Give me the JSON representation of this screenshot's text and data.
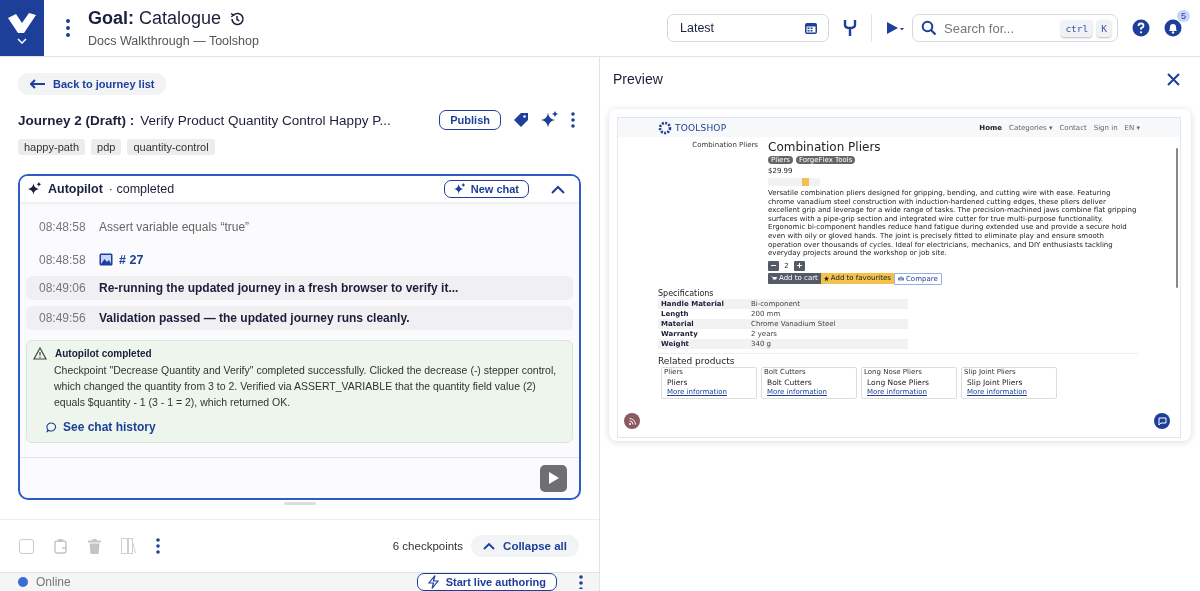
{
  "header": {
    "goal_label": "Goal:",
    "goal_name": "Catalogue",
    "subtitle": "Docs Walkthrough — Toolshop",
    "version": "Latest",
    "search_placeholder": "Search for...",
    "shortcut": [
      "ctrl",
      "K"
    ],
    "notifications": "5"
  },
  "back": "Back to journey list",
  "journey": {
    "prefix": "Journey 2 (Draft) :",
    "title": "Verify Product Quantity Control Happy P...",
    "publish": "Publish",
    "tags": [
      "happy-path",
      "pdp",
      "quantity-control"
    ]
  },
  "autopilot": {
    "title": "Autopilot",
    "status": "· completed",
    "new_chat": "New chat",
    "expanded": true,
    "log": [
      {
        "kind": "text",
        "time": "08:48:58",
        "text": "Assert variable equals “true”"
      },
      {
        "kind": "image",
        "time": "08:48:58",
        "text": "# 27"
      },
      {
        "kind": "status",
        "time": "08:49:06",
        "text": "Re-running the updated journey in a fresh browser to verify it..."
      },
      {
        "kind": "status",
        "time": "08:49:56",
        "text": "Validation passed — the updated journey runs cleanly."
      }
    ],
    "result": {
      "title": "Autopilot completed",
      "body": "Checkpoint \"Decrease Quantity and Verify\" completed successfully. Clicked the decrease (-) stepper control, which changed the quantity from 3 to 2. Verified via ASSERT_VARIABLE that the quantity field value (2) equals $quantity - 1 (3 - 1 = 2), which returned OK.",
      "link": "See chat history"
    }
  },
  "toolbar": {
    "checked": false,
    "count": "6 checkpoints",
    "collapse": "Collapse all"
  },
  "status": {
    "label": "Online",
    "online": true,
    "button": "Start live authoring"
  },
  "preview": {
    "title": "Preview",
    "page": {
      "logo": "TOOLSHOP",
      "nav": [
        {
          "label": "Home",
          "selected": true
        },
        {
          "label": "Categories ▾",
          "selected": false
        },
        {
          "label": "Contact",
          "selected": false
        },
        {
          "label": "Sign in",
          "selected": false
        },
        {
          "label": "EN ▾",
          "selected": false
        }
      ],
      "image_alt": "Combination Pliers",
      "name": "Combination Pliers",
      "badges": [
        "Pliers",
        "ForgeFlex Tools"
      ],
      "price": "$29.99",
      "description": "Versatile combination pliers designed for gripping, bending, and cutting wire with ease. Featuring chrome vanadium steel construction with induction-hardened cutting edges, these pliers deliver excellent grip and leverage for a wide range of tasks. The precision-machined jaws combine flat gripping surfaces with a pipe-grip section and integrated wire cutter for true multi-purpose functionality. Ergonomic bi-component handles reduce hand fatigue during extended use and provide a secure hold even with oily or gloved hands. The joint is precisely fitted to eliminate play and ensure smooth operation over thousands of cycles. Ideal for electricians, mechanics, and DIY enthusiasts tackling everyday projects around the workshop or job site.",
      "quantity": "2",
      "buttons": [
        {
          "kind": "cart",
          "label": "Add to cart"
        },
        {
          "kind": "favourite",
          "label": "Add to favourites"
        },
        {
          "kind": "compare",
          "label": "Compare"
        }
      ],
      "specs_title": "Specifications",
      "specs": [
        {
          "name": "Handle Material",
          "value": "Bi-component"
        },
        {
          "name": "Length",
          "value": "200 mm"
        },
        {
          "name": "Material",
          "value": "Chrome Vanadium Steel"
        },
        {
          "name": "Warranty",
          "value": "2 years"
        },
        {
          "name": "Weight",
          "value": "340 g"
        }
      ],
      "related_title": "Related products",
      "related": [
        {
          "alt": "Pliers",
          "name": "Pliers",
          "link": "More information"
        },
        {
          "alt": "Bolt Cutters",
          "name": "Bolt Cutters",
          "link": "More information"
        },
        {
          "alt": "Long Nose Pliers",
          "name": "Long Nose Pliers",
          "link": "More information"
        },
        {
          "alt": "Slip Joint Pliers",
          "name": "Slip Joint Pliers",
          "link": "More information"
        }
      ]
    }
  }
}
